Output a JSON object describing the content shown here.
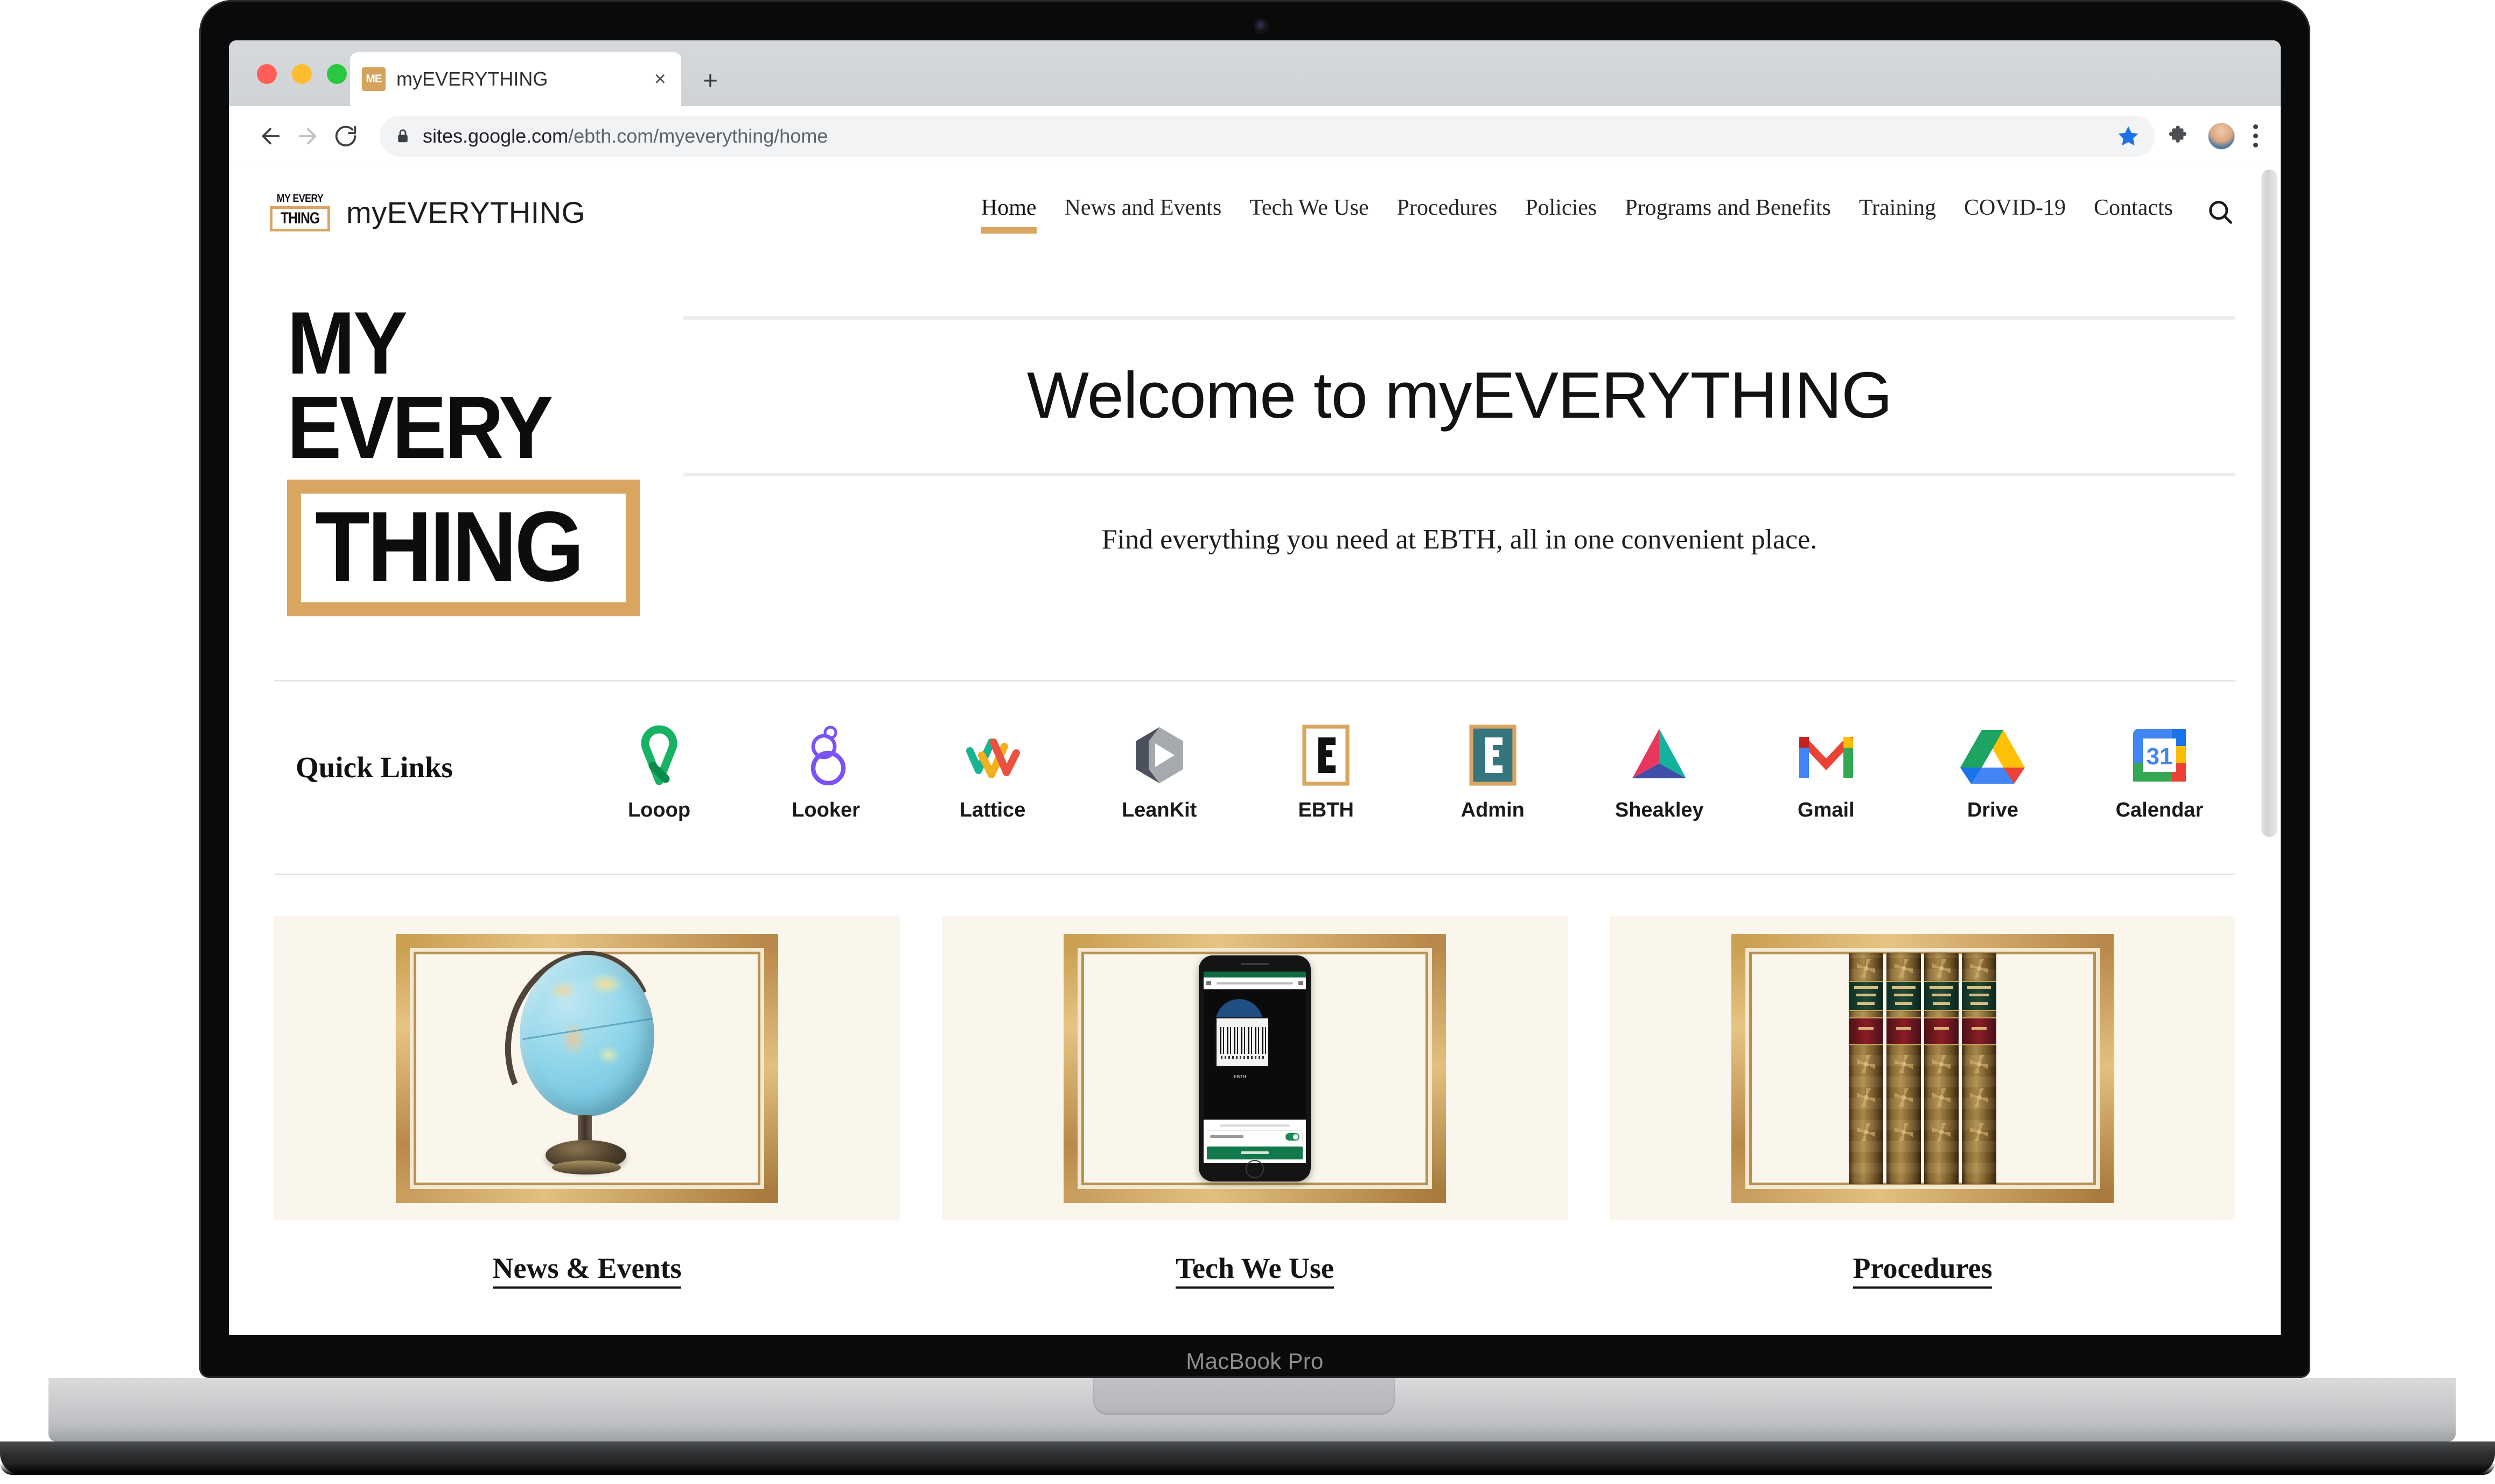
{
  "device": {
    "model_label": "MacBook Pro"
  },
  "browser": {
    "tab": {
      "favicon_text": "ME",
      "title": "myEVERYTHING",
      "close_icon": "×"
    },
    "new_tab_icon": "+",
    "toolbar": {
      "back_icon": "back-arrow-icon",
      "forward_icon": "forward-arrow-icon",
      "reload_icon": "reload-icon",
      "lock_icon": "lock-icon",
      "url_domain": "sites.google.com",
      "url_path": "/ebth.com/myeverything/home",
      "bookmark_icon": "star-icon",
      "bookmark_color": "#1a73e8",
      "extensions_icon": "puzzle-piece-icon",
      "profile_icon": "avatar",
      "menu_icon": "kebab-menu-icon"
    }
  },
  "site": {
    "logo": {
      "line1": "MY EVERY",
      "line2": "THING"
    },
    "title": "myEVERYTHING",
    "accent_color": "#d9a662",
    "nav": {
      "items": [
        {
          "label": "Home",
          "active": true
        },
        {
          "label": "News and Events",
          "active": false
        },
        {
          "label": "Tech We Use",
          "active": false
        },
        {
          "label": "Procedures",
          "active": false
        },
        {
          "label": "Policies",
          "active": false
        },
        {
          "label": "Programs and Benefits",
          "active": false
        },
        {
          "label": "Training",
          "active": false
        },
        {
          "label": "COVID-19",
          "active": false
        },
        {
          "label": "Contacts",
          "active": false
        }
      ],
      "search_icon": "search-icon"
    }
  },
  "hero": {
    "logo": {
      "line1": "MY EVERY",
      "line2": "THING"
    },
    "heading": "Welcome to myEVERYTHING",
    "subtitle": "Find everything you need at EBTH, all in one convenient place."
  },
  "quick_links": {
    "title": "Quick Links",
    "items": [
      {
        "label": "Looop",
        "icon": "looop-icon",
        "color": "#16b364"
      },
      {
        "label": "Looker",
        "icon": "looker-icon",
        "color": "#6c44f0"
      },
      {
        "label": "Lattice",
        "icon": "lattice-icon",
        "color": "#16b394"
      },
      {
        "label": "LeanKit",
        "icon": "leankit-icon",
        "color": "#9b9ea3"
      },
      {
        "label": "EBTH",
        "icon": "ebth-icon",
        "color": "#d9a662"
      },
      {
        "label": "Admin",
        "icon": "admin-icon",
        "color": "#37757e"
      },
      {
        "label": "Sheakley",
        "icon": "sheakley-icon",
        "color": "#e8365d"
      },
      {
        "label": "Gmail",
        "icon": "gmail-icon",
        "color": "#ea4335"
      },
      {
        "label": "Drive",
        "icon": "drive-icon",
        "color": "#00a94f"
      },
      {
        "label": "Calendar",
        "icon": "calendar-icon",
        "color": "#4285f4",
        "day": "31"
      }
    ]
  },
  "cards": [
    {
      "caption": "News & Events",
      "art": "framed-globe"
    },
    {
      "caption": "Tech We Use",
      "art": "framed-phone"
    },
    {
      "caption": "Procedures",
      "art": "framed-books"
    }
  ]
}
